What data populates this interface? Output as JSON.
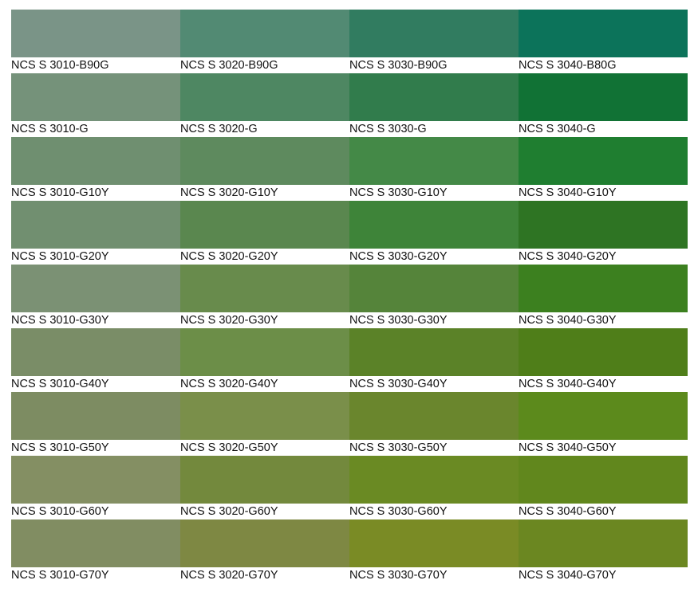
{
  "swatches": [
    {
      "label": "NCS S 3010-B90G",
      "color": "#7a9487"
    },
    {
      "label": "NCS S 3020-B90G",
      "color": "#528a73"
    },
    {
      "label": "NCS S 3030-B90G",
      "color": "#317c60"
    },
    {
      "label": "NCS S 3040-B80G",
      "color": "#0c735a"
    },
    {
      "label": "NCS S 3010-G",
      "color": "#75927a"
    },
    {
      "label": "NCS S 3020-G",
      "color": "#4e8762"
    },
    {
      "label": "NCS S 3030-G",
      "color": "#317c4c"
    },
    {
      "label": "NCS S 3040-G",
      "color": "#117235"
    },
    {
      "label": "NCS S 3010-G10Y",
      "color": "#6f8f70"
    },
    {
      "label": "NCS S 3020-G10Y",
      "color": "#5e8a5e"
    },
    {
      "label": "NCS S 3030-G10Y",
      "color": "#448947"
    },
    {
      "label": "NCS S 3040-G10Y",
      "color": "#1f7e30"
    },
    {
      "label": "NCS S 3010-G20Y",
      "color": "#718f70"
    },
    {
      "label": "NCS S 3020-G20Y",
      "color": "#5a874f"
    },
    {
      "label": "NCS S 3030-G20Y",
      "color": "#3e8439"
    },
    {
      "label": "NCS S 3040-G20Y",
      "color": "#2e7423"
    },
    {
      "label": "NCS S 3010-G30Y",
      "color": "#7b9174"
    },
    {
      "label": "NCS S 3020-G30Y",
      "color": "#688b4c"
    },
    {
      "label": "NCS S 3030-G30Y",
      "color": "#55843a"
    },
    {
      "label": "NCS S 3040-G30Y",
      "color": "#3c801f"
    },
    {
      "label": "NCS S 3010-G40Y",
      "color": "#7a8d67"
    },
    {
      "label": "NCS S 3020-G40Y",
      "color": "#6c8e48"
    },
    {
      "label": "NCS S 3030-G40Y",
      "color": "#5b8228"
    },
    {
      "label": "NCS S 3040-G40Y",
      "color": "#4f7e19"
    },
    {
      "label": "NCS S 3010-G50Y",
      "color": "#7d8c62"
    },
    {
      "label": "NCS S 3020-G50Y",
      "color": "#7a8f4a"
    },
    {
      "label": "NCS S 3030-G50Y",
      "color": "#6a862d"
    },
    {
      "label": "NCS S 3040-G50Y",
      "color": "#5c8a1c"
    },
    {
      "label": "NCS S 3010-G60Y",
      "color": "#848f63"
    },
    {
      "label": "NCS S 3020-G60Y",
      "color": "#73893d"
    },
    {
      "label": "NCS S 3030-G60Y",
      "color": "#6a8a23"
    },
    {
      "label": "NCS S 3040-G60Y",
      "color": "#61871d"
    },
    {
      "label": "NCS S 3010-G70Y",
      "color": "#818d62"
    },
    {
      "label": "NCS S 3020-G70Y",
      "color": "#7e8843"
    },
    {
      "label": "NCS S 3030-G70Y",
      "color": "#7a8b25"
    },
    {
      "label": "NCS S 3040-G70Y",
      "color": "#6b8721"
    }
  ]
}
